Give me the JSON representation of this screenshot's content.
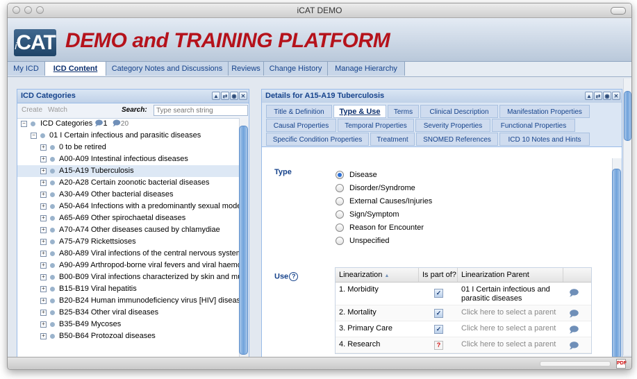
{
  "window": {
    "title": "iCAT DEMO"
  },
  "header": {
    "logo_text": "CAT",
    "logo_prefix": "i",
    "app_title": "DEMO and TRAINING PLATFORM"
  },
  "nav": {
    "tabs": [
      {
        "label": "My ICD",
        "active": false
      },
      {
        "label": "ICD Content",
        "active": true
      },
      {
        "label": "Category Notes and Discussions",
        "active": false
      },
      {
        "label": "Reviews",
        "active": false
      },
      {
        "label": "Change History",
        "active": false
      },
      {
        "label": "Manage Hierarchy",
        "active": false
      }
    ]
  },
  "left_panel": {
    "title": "ICD Categories",
    "create_label": "Create",
    "watch_label": "Watch",
    "search_label": "Search:",
    "search_placeholder": "Type search string",
    "root": {
      "label": "ICD Categories",
      "count_a": "1",
      "count_b": "20"
    },
    "chapter": "01 I Certain infectious and parasitic diseases",
    "items": [
      {
        "label": "0 to be retired",
        "selected": false
      },
      {
        "label": "A00-A09 Intestinal infectious diseases",
        "selected": false
      },
      {
        "label": "A15-A19 Tuberculosis",
        "selected": true
      },
      {
        "label": "A20-A28 Certain zoonotic bacterial diseases",
        "selected": false
      },
      {
        "label": "A30-A49 Other bacterial diseases",
        "selected": false
      },
      {
        "label": "A50-A64 Infections with a predominantly sexual mode",
        "selected": false
      },
      {
        "label": "A65-A69 Other spirochaetal diseases",
        "selected": false
      },
      {
        "label": "A70-A74 Other diseases caused by chlamydiae",
        "selected": false
      },
      {
        "label": "A75-A79 Rickettsioses",
        "selected": false
      },
      {
        "label": "A80-A89 Viral infections of the central nervous system",
        "selected": false
      },
      {
        "label": "A90-A99 Arthropod-borne viral fevers and viral haemo",
        "selected": false
      },
      {
        "label": "B00-B09 Viral infections characterized by skin and mu",
        "selected": false
      },
      {
        "label": "B15-B19 Viral hepatitis",
        "selected": false
      },
      {
        "label": "B20-B24 Human immunodeficiency virus [HIV] disease",
        "selected": false
      },
      {
        "label": "B25-B34 Other viral diseases",
        "selected": false
      },
      {
        "label": "B35-B49 Mycoses",
        "selected": false
      },
      {
        "label": "B50-B64 Protozoal diseases",
        "selected": false
      }
    ]
  },
  "right_panel": {
    "title": "Details for A15-A19 Tuberculosis",
    "tabs": [
      {
        "label": "Title & Definition",
        "active": false
      },
      {
        "label": "Type & Use",
        "active": true
      },
      {
        "label": "Terms",
        "active": false
      },
      {
        "label": "Clinical Description",
        "active": false
      },
      {
        "label": "Manifestation Properties",
        "active": false
      },
      {
        "label": "Causal Properties",
        "active": false
      },
      {
        "label": "Temporal Properties",
        "active": false
      },
      {
        "label": "Severity Properties",
        "active": false
      },
      {
        "label": "Functional Properties",
        "active": false
      },
      {
        "label": "Specific Condition Properties",
        "active": false
      },
      {
        "label": "Treatment",
        "active": false
      },
      {
        "label": "SNOMED References",
        "active": false
      },
      {
        "label": "ICD 10 Notes and Hints",
        "active": false
      }
    ],
    "type_label": "Type",
    "type_options": [
      {
        "label": "Disease",
        "selected": true
      },
      {
        "label": "Disorder/Syndrome",
        "selected": false
      },
      {
        "label": "External Causes/Injuries",
        "selected": false
      },
      {
        "label": "Sign/Symptom",
        "selected": false
      },
      {
        "label": "Reason for Encounter",
        "selected": false
      },
      {
        "label": "Unspecified",
        "selected": false
      }
    ],
    "use_label": "Use",
    "use_help": "?",
    "grid": {
      "headers": {
        "linearization": "Linearization",
        "sort_arrow": "▲",
        "is_part_of": "Is part of?",
        "parent": "Linearization Parent"
      },
      "rows": [
        {
          "linearization": "1. Morbidity",
          "part_of": "checked",
          "parent_line1": "01 I Certain infectious and",
          "parent_line2": "parasitic diseases",
          "muted": false
        },
        {
          "linearization": "2. Mortality",
          "part_of": "checked",
          "parent_line1": "Click here to select a parent",
          "parent_line2": "",
          "muted": true
        },
        {
          "linearization": "3. Primary Care",
          "part_of": "checked",
          "parent_line1": "Click here to select a parent",
          "parent_line2": "",
          "muted": true
        },
        {
          "linearization": "4. Research",
          "part_of": "unknown",
          "parent_line1": "Click here to select a parent",
          "parent_line2": "",
          "muted": true
        }
      ]
    }
  },
  "icons": {
    "tool_buttons": [
      "collapse-icon",
      "refresh-icon",
      "print-icon",
      "close-icon"
    ],
    "comment": "comment-bubble-icon"
  },
  "colors": {
    "title_red": "#b5121b",
    "accent_blue": "#15428b",
    "header_bg": "#c8d6e8"
  }
}
